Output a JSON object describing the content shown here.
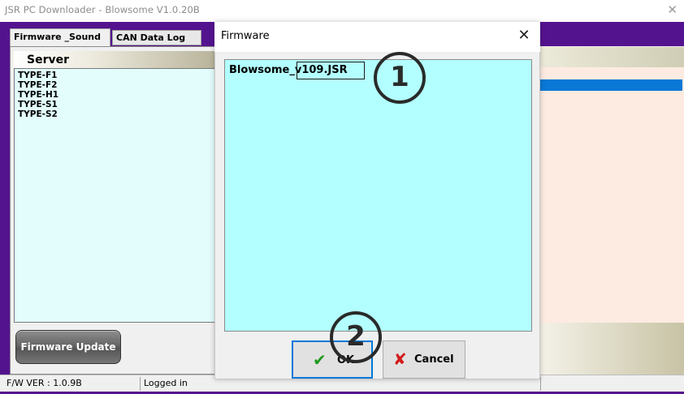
{
  "window": {
    "title": "JSR PC Downloader - Blowsome V1.0.20B",
    "close_glyph": "✕"
  },
  "tabs": [
    {
      "label": "Firmware _Sound"
    },
    {
      "label": "CAN Data Log"
    }
  ],
  "server_panel": {
    "header": "Server",
    "items": [
      "TYPE-F1",
      "TYPE-F2",
      "TYPE-H1",
      "TYPE-S1",
      "TYPE-S2"
    ]
  },
  "firmware_update_button": "Firmware Update",
  "status": {
    "fw_version": "F/W VER : 1.0.9B",
    "login": "Logged in"
  },
  "dialog": {
    "title": "Firmware",
    "close_glyph": "✕",
    "file_prefix": "Blowsome_",
    "file_version": "v109.JSR",
    "ok_label": "OK",
    "cancel_label": "Cancel",
    "ok_icon": "✔",
    "cancel_icon": "✘"
  },
  "callouts": {
    "one": "1",
    "two": "2"
  },
  "colors": {
    "window_frame": "#54138e",
    "file_list_bg": "#b3ffff",
    "server_list_bg": "#e3fdfd",
    "selection": "#0a78d7"
  },
  "icons": [
    "close-icon",
    "check-icon",
    "cross-icon"
  ]
}
